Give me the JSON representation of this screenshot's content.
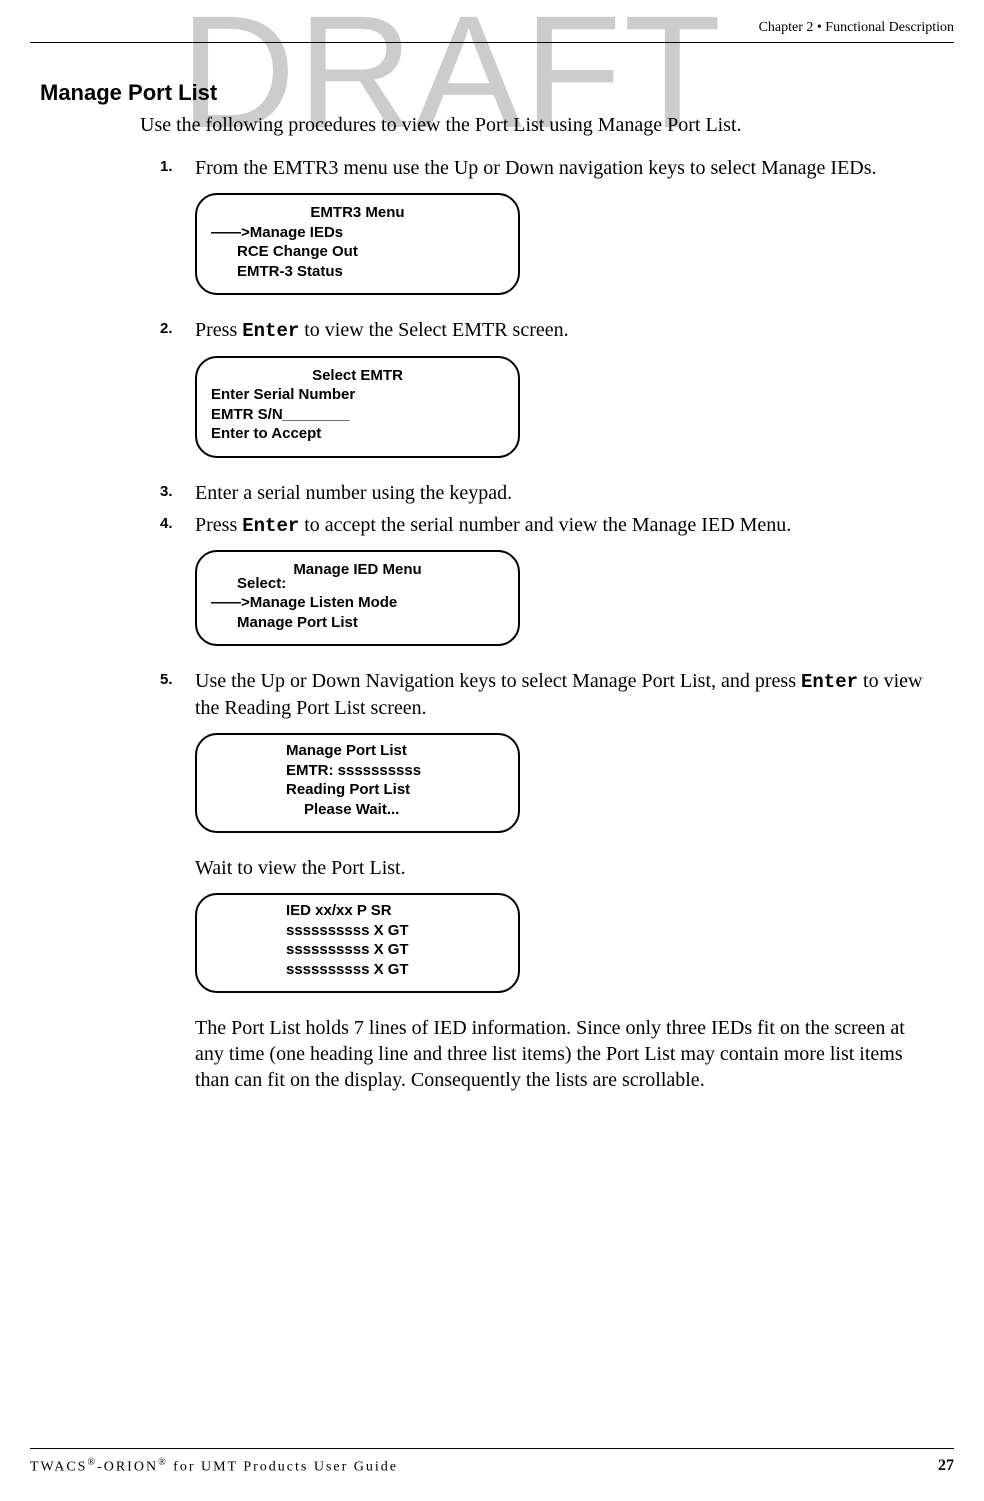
{
  "watermark": "DRAFT",
  "header": {
    "chapter": "Chapter 2 • Functional Description"
  },
  "section": {
    "title": "Manage Port List",
    "intro": "Use the following procedures to view the Port List using Manage Port List."
  },
  "steps": {
    "s1": {
      "num": "1.",
      "text": "From the EMTR3 menu use the Up or Down navigation keys to select Manage IEDs."
    },
    "s2": {
      "num": "2.",
      "prefix": "Press ",
      "enter": "Enter",
      "suffix": " to view the Select EMTR screen."
    },
    "s3": {
      "num": "3.",
      "text": "Enter a serial number using the keypad."
    },
    "s4": {
      "num": "4.",
      "prefix": "Press ",
      "enter": "Enter",
      "suffix": " to accept the serial number and view the Manage IED Menu."
    },
    "s5": {
      "num": "5.",
      "prefix": "Use the Up or Down Navigation keys to select Manage Port List, and press ",
      "enter": "Enter",
      "suffix": " to view the Reading Port List screen."
    }
  },
  "lcd": {
    "screen1": {
      "title": "EMTR3 Menu",
      "line1": "——>Manage IEDs",
      "line2": "RCE Change Out",
      "line3": "EMTR-3 Status"
    },
    "screen2": {
      "title": "Select EMTR",
      "line1": "Enter Serial Number",
      "line2": "EMTR S/N________",
      "line3": "Enter to Accept"
    },
    "screen3": {
      "title": "Manage IED Menu",
      "select": "Select:",
      "line1": "——>Manage Listen Mode",
      "line2": "Manage Port List"
    },
    "screen4": {
      "line1": "Manage Port List",
      "line2": "EMTR: ssssssssss",
      "line3": "Reading Port List",
      "line4": "Please Wait..."
    },
    "screen5": {
      "line1": "IED xx/xx P SR",
      "line2": "ssssssssss X GT",
      "line3": "ssssssssss X GT",
      "line4": "ssssssssss X GT"
    }
  },
  "body": {
    "wait": "Wait to view the Port List.",
    "para": "The Port List holds 7 lines of IED information. Since only three IEDs fit on the screen at any time (one heading line and three list items) the Port List may contain more list items than can fit on the display. Consequently the lists are scrollable."
  },
  "footer": {
    "left_full": "TWACS®-ORION® for UMT Products User Guide",
    "page": "27"
  }
}
